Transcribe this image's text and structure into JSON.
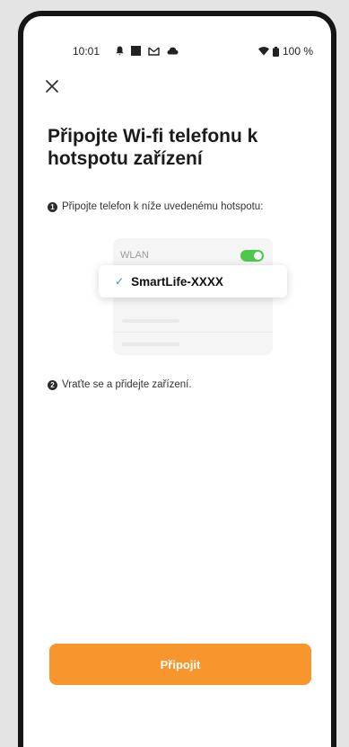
{
  "status_bar": {
    "time": "10:01",
    "battery_text": "100 %",
    "icons_left": [
      "notification-icon",
      "square-icon",
      "gmail-icon",
      "cloud-icon"
    ],
    "icons_right": [
      "wifi-icon",
      "battery-icon"
    ]
  },
  "header": {
    "close_icon": "close-icon"
  },
  "page": {
    "title": "Připojte Wi-fi telefonu k hotspotu zařízení",
    "step1_number": "1",
    "step1_text": "Připojte telefon k níže uvedenému hotspotu:",
    "step2_number": "2",
    "step2_text": "Vraťte se a přidejte zařízení."
  },
  "illustration": {
    "wlan_label": "WLAN",
    "wlan_enabled": true,
    "network_name": "SmartLife-XXXX",
    "network_selected": true
  },
  "actions": {
    "connect_label": "Připojit"
  },
  "colors": {
    "accent": "#f7962c",
    "toggle_on": "#4cc94c",
    "check": "#2b8cf0"
  }
}
